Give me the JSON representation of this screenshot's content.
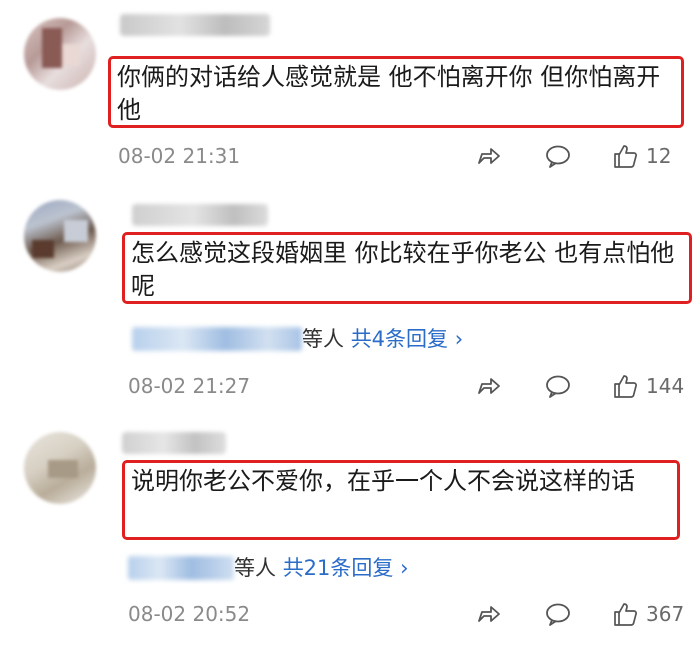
{
  "comments": [
    {
      "text": "你俩的对话给人感觉就是 他不怕离开你 但你怕离开他",
      "time": "08-02 21:31",
      "likes": "12",
      "replies": null
    },
    {
      "text": "怎么感觉这段婚姻里 你比较在乎你老公 也有点怕他呢",
      "time": "08-02 21:27",
      "likes": "144",
      "replies": {
        "suffix": "等人",
        "link": "共4条回复 ›"
      }
    },
    {
      "text": "说明你老公不爱你，在乎一个人不会说这样的话",
      "time": "08-02 20:52",
      "likes": "367",
      "replies": {
        "suffix": "等人",
        "link": "共21条回复 ›"
      }
    }
  ],
  "icons": {
    "share": "share-icon",
    "comment": "comment-icon",
    "like": "like-icon"
  },
  "colors": {
    "highlight_border": "#e02020",
    "link": "#2a6cc8",
    "meta": "#8a8a8a"
  }
}
